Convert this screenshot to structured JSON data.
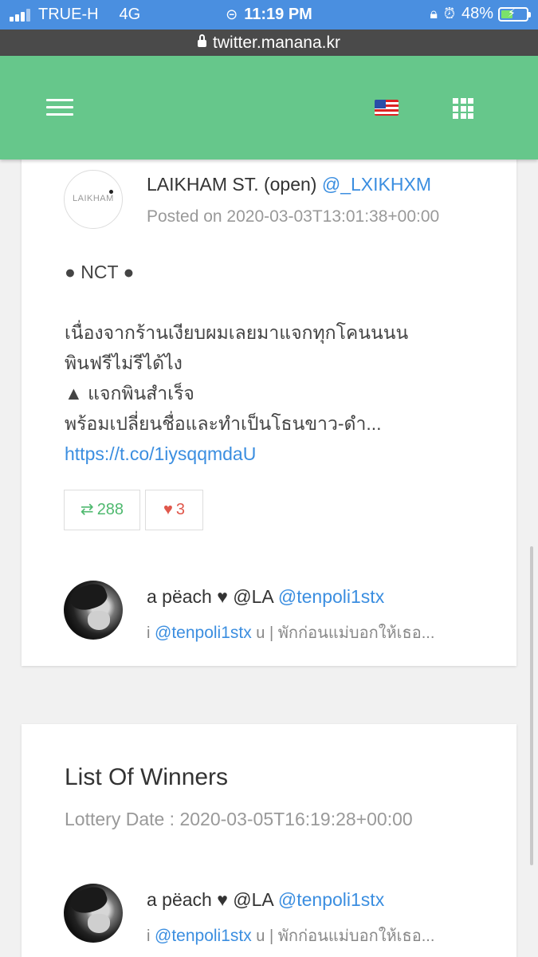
{
  "status_bar": {
    "carrier": "TRUE-H",
    "network": "4G",
    "time": "11:19 PM",
    "battery": "48%",
    "battery_level": 0.48,
    "icons": [
      "signal-icon",
      "link-icon",
      "orientation-lock-icon",
      "alarm-icon",
      "battery-icon"
    ]
  },
  "url_bar": {
    "url": "twitter.manana.kr"
  },
  "header": {
    "icons": [
      "menu-icon",
      "us-flag-icon",
      "apps-grid-icon"
    ],
    "color": "#66c78b"
  },
  "tweet": {
    "author_name": "LAIKHAM ST. (open)",
    "author_handle": "@_LXIKHXM",
    "avatar_text": "LAIKHAM",
    "posted": "Posted on 2020-03-03T13:01:38+00:00",
    "lines": [
      "● NCT ●",
      "",
      "เนื่องจากร้านเงียบผมเลยมาแจกทุกโคนนนน",
      "พินฟรีไม่รีได้ไง",
      "▲ แจกพินสำเร็จ",
      "พร้อมเปลี่ยนชื่อและทำเป็นโธนขาว-ดำ..."
    ],
    "link": "https://t.co/1iysqqmdaU",
    "retweets": "288",
    "likes": "3"
  },
  "reply": {
    "name": "a pëach ♥ @LA",
    "handle": "@tenpoli1stx",
    "line_prefix": "i",
    "line_handle": "@tenpoli1stx",
    "line_suffix": "u | พักก่อนแม่บอกให้เธอ..."
  },
  "winners": {
    "title": "List Of Winners",
    "lottery_date": "Lottery Date : 2020-03-05T16:19:28+00:00",
    "entries": [
      {
        "name": "a pëach ♥ @LA",
        "handle": "@tenpoli1stx",
        "line_prefix": "i",
        "line_handle": "@tenpoli1stx",
        "line_suffix": "u | พักก่อนแม่บอกให้เธอ..."
      }
    ]
  },
  "colors": {
    "status_bar": "#4a8fe0",
    "link": "#3b8ee0",
    "retweet": "#4fb96f",
    "like": "#e0584c"
  }
}
